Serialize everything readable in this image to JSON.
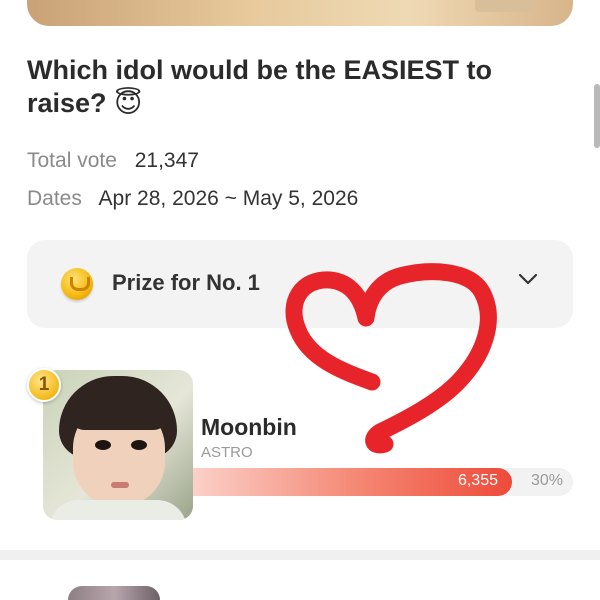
{
  "poll": {
    "title": "Which idol would be the EASIEST to raise?",
    "title_emoji": "😇",
    "total_vote_label": "Total vote",
    "total_vote_value": "21,347",
    "dates_label": "Dates",
    "dates_value": "Apr 28, 2026 ~ May 5, 2026"
  },
  "prize": {
    "label": "Prize for No. 1",
    "icon": "coin-icon",
    "expand_icon": "chevron-down-icon"
  },
  "ranking": [
    {
      "rank": "1",
      "name": "Moonbin",
      "group": "ASTRO",
      "votes": "6,355",
      "percent": "30%",
      "share": 0.84
    }
  ],
  "colors": {
    "bar_start": "#fbd0c8",
    "bar_end": "#ee4a3a",
    "heart_scribble": "#e8242b",
    "badge_gold": "#f3b91a",
    "prize_box_bg": "#f3f3f3"
  }
}
